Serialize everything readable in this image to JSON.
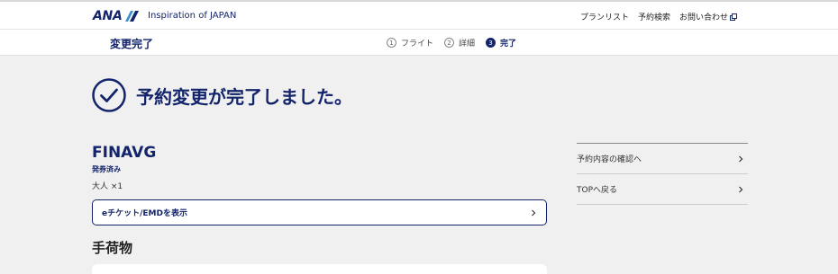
{
  "header": {
    "logo_text": "ANA",
    "tagline": "Inspiration of JAPAN",
    "nav": [
      "プランリスト",
      "予約検索",
      "お問い合わせ"
    ],
    "brand_color": "#13246b"
  },
  "subheader": {
    "title": "変更完了",
    "steps": [
      {
        "num": "1",
        "label": "フライト",
        "active": false
      },
      {
        "num": "2",
        "label": "詳細",
        "active": false
      },
      {
        "num": "3",
        "label": "完了",
        "active": true
      }
    ]
  },
  "main": {
    "done_message": "予約変更が完了しました。",
    "fare_name": "FINAVG",
    "fare_status": "発券済み",
    "passengers": "大人 ×1",
    "eticket_label": "eチケット/EMDを表示",
    "section_title": "手荷物"
  },
  "sidebar": {
    "links": [
      "予約内容の確認へ",
      "TOPへ戻る"
    ]
  }
}
